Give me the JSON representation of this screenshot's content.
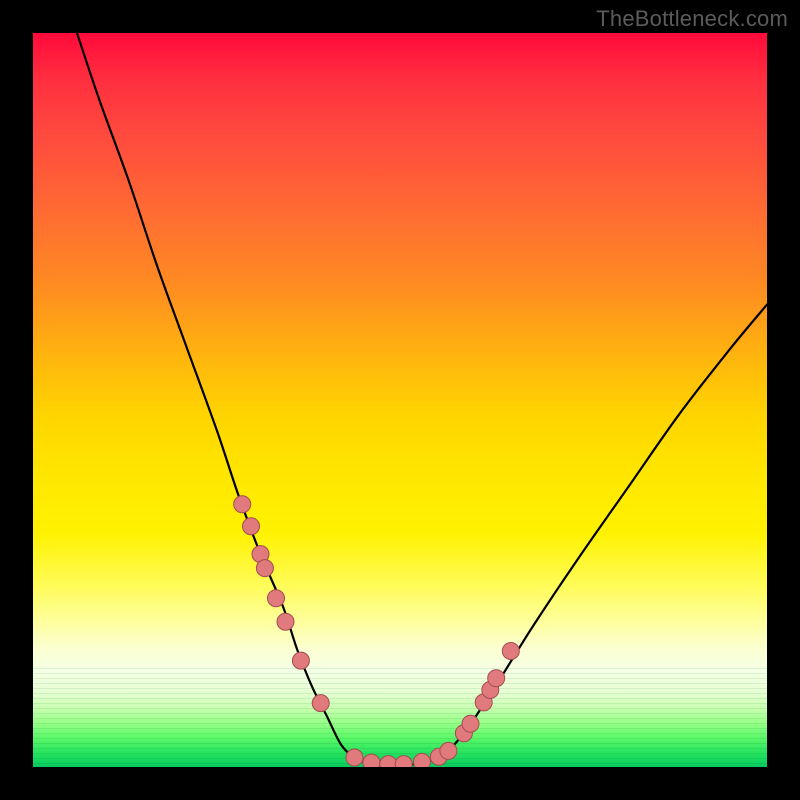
{
  "watermark": "TheBottleneck.com",
  "colors": {
    "dot_fill": "#e17a7c",
    "dot_stroke": "#a34c50",
    "curve": "#000000",
    "frame": "#000000"
  },
  "chart_data": {
    "type": "line",
    "title": "",
    "xlabel": "",
    "ylabel": "",
    "xlim": [
      0,
      100
    ],
    "ylim": [
      0,
      100
    ],
    "grid": false,
    "legend": false,
    "note": "Axes are unlabeled; values are estimated from pixel positions on a 0–100 normalized scale (origin at bottom-left).",
    "series": [
      {
        "name": "left-branch",
        "x": [
          6,
          9,
          13,
          17,
          21,
          25,
          28,
          31,
          34,
          36,
          38,
          40,
          42,
          44
        ],
        "y": [
          100,
          91,
          80,
          68,
          57,
          46,
          37,
          29,
          22,
          16,
          11,
          7,
          3,
          1
        ]
      },
      {
        "name": "valley-floor",
        "x": [
          44,
          46,
          48,
          50,
          52,
          54,
          56
        ],
        "y": [
          1,
          0.5,
          0.3,
          0.3,
          0.4,
          0.8,
          1.5
        ]
      },
      {
        "name": "right-branch",
        "x": [
          56,
          59,
          63,
          68,
          74,
          81,
          88,
          95,
          100
        ],
        "y": [
          1.5,
          5,
          11,
          19,
          28,
          38,
          48,
          57,
          63
        ]
      }
    ],
    "points": {
      "name": "highlighted-dots",
      "x": [
        28.5,
        29.7,
        31.0,
        31.6,
        33.1,
        34.4,
        36.5,
        39.2,
        43.8,
        46.1,
        48.4,
        50.5,
        53.0,
        55.3,
        56.6,
        58.7,
        59.6,
        61.4,
        62.3,
        63.1,
        65.1
      ],
      "y": [
        35.8,
        32.8,
        29.0,
        27.1,
        23.0,
        19.8,
        14.5,
        8.7,
        1.3,
        0.6,
        0.4,
        0.4,
        0.7,
        1.4,
        2.2,
        4.6,
        5.9,
        8.8,
        10.5,
        12.1,
        15.8
      ]
    },
    "background_gradient": {
      "orientation": "vertical",
      "stops": [
        {
          "pos": 0.0,
          "color": "#ff0a3a"
        },
        {
          "pos": 0.5,
          "color": "#ffd400"
        },
        {
          "pos": 0.82,
          "color": "#feff9a"
        },
        {
          "pos": 1.0,
          "color": "#07ca5e"
        }
      ]
    }
  }
}
